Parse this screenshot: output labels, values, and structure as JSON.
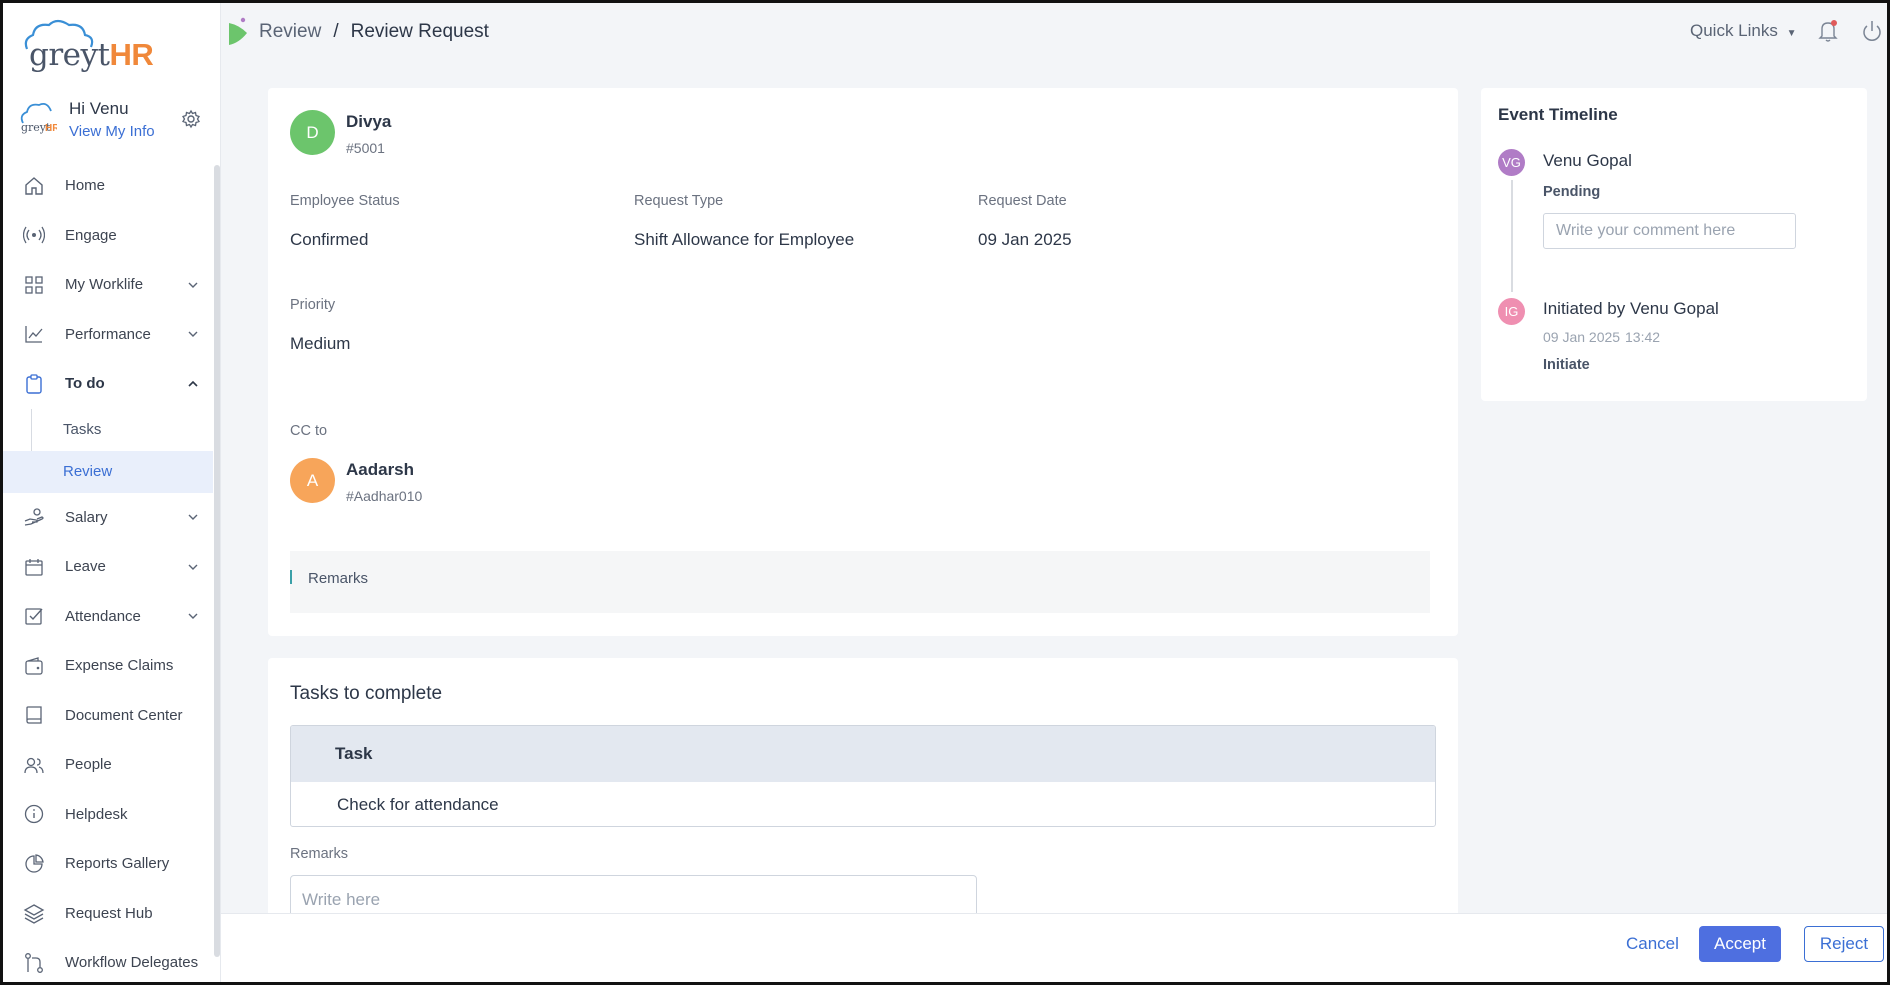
{
  "brand": {
    "logo_text_1": "greyt",
    "logo_text_2": "HR",
    "color_accent": "#f0883a"
  },
  "user": {
    "greeting": "Hi Venu",
    "link": "View My Info",
    "avatar_icon": "greythr-avatar-icon"
  },
  "sidebar": {
    "items": [
      {
        "label": "Home",
        "icon": "home-icon"
      },
      {
        "label": "Engage",
        "icon": "broadcast-icon"
      },
      {
        "label": "My Worklife",
        "icon": "grid-icon",
        "expandable": true
      },
      {
        "label": "Performance",
        "icon": "chart-line-icon",
        "expandable": true
      },
      {
        "label": "To do",
        "icon": "clipboard-icon",
        "expanded": true
      },
      {
        "label": "Salary",
        "icon": "hand-money-icon",
        "expandable": true
      },
      {
        "label": "Leave",
        "icon": "calendar-icon",
        "expandable": true
      },
      {
        "label": "Attendance",
        "icon": "checkbox-icon",
        "expandable": true
      },
      {
        "label": "Expense Claims",
        "icon": "wallet-icon"
      },
      {
        "label": "Document Center",
        "icon": "book-icon"
      },
      {
        "label": "People",
        "icon": "people-icon"
      },
      {
        "label": "Helpdesk",
        "icon": "info-icon"
      },
      {
        "label": "Reports Gallery",
        "icon": "pie-chart-icon"
      },
      {
        "label": "Request Hub",
        "icon": "layers-icon"
      },
      {
        "label": "Workflow Delegates",
        "icon": "workflow-icon"
      }
    ],
    "todo_sub": [
      {
        "label": "Tasks"
      },
      {
        "label": "Review",
        "active": true
      }
    ]
  },
  "header": {
    "breadcrumb_1": "Review",
    "breadcrumb_sep": "/",
    "breadcrumb_2": "Review Request",
    "quick_links": "Quick Links"
  },
  "request": {
    "employee_initial": "D",
    "employee_name": "Divya",
    "employee_id": "#5001",
    "employee_status_label": "Employee Status",
    "employee_status": "Confirmed",
    "request_type_label": "Request Type",
    "request_type": "Shift Allowance for Employee",
    "request_date_label": "Request Date",
    "request_date": "09 Jan 2025",
    "priority_label": "Priority",
    "priority": "Medium",
    "cc_label": "CC to",
    "cc_initial": "A",
    "cc_name": "Aadarsh",
    "cc_id": "#Aadhar010",
    "remarks_label": "Remarks"
  },
  "tasks": {
    "title": "Tasks to complete",
    "header": "Task",
    "rows": [
      "Check for attendance"
    ],
    "remarks_label": "Remarks",
    "remarks_placeholder": "Write here"
  },
  "timeline": {
    "title": "Event Timeline",
    "events": [
      {
        "initials": "VG",
        "name": "Venu Gopal",
        "status": "Pending",
        "color": "#b07cc6"
      },
      {
        "initials": "IG",
        "name": "Initiated by Venu Gopal",
        "date": "09 Jan 2025",
        "time": "13:42",
        "status": "Initiate",
        "color": "#ef8fb1"
      }
    ],
    "comment_placeholder": "Write your comment here"
  },
  "footer": {
    "cancel": "Cancel",
    "accept": "Accept",
    "reject": "Reject"
  },
  "colors": {
    "primary": "#4e6fe0",
    "link": "#3b6fd4",
    "avatar_green": "#6cc56c",
    "avatar_orange": "#f7a55a"
  }
}
